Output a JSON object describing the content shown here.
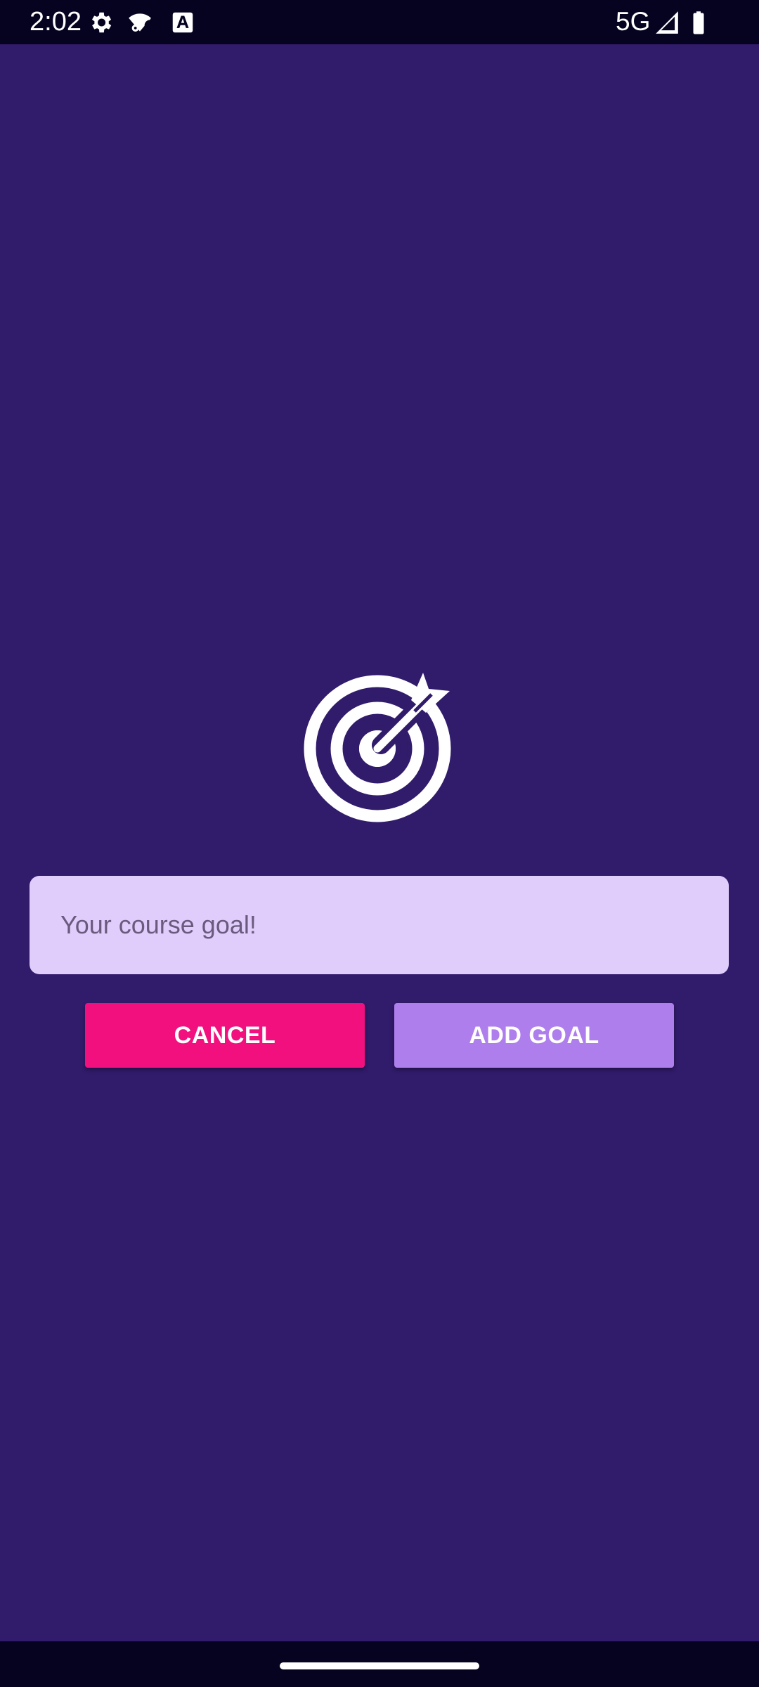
{
  "status_bar": {
    "time": "2:02",
    "network": "5G",
    "icons": [
      "settings-gear-icon",
      "wifi-settings-icon",
      "font-a-icon",
      "signal-icon",
      "battery-icon"
    ]
  },
  "main": {
    "goal_image_icon": "target-dartboard-icon",
    "goal_input": {
      "placeholder": "Your course goal!",
      "value": ""
    },
    "cancel_label": "CANCEL",
    "add_goal_label": "ADD GOAL"
  },
  "colors": {
    "background": "#311b6b",
    "system_bars": "#060320",
    "input_background": "#e1cdfb",
    "cancel_button": "#f2107f",
    "add_goal_button": "#ae7eec",
    "icon": "#ffffff"
  }
}
